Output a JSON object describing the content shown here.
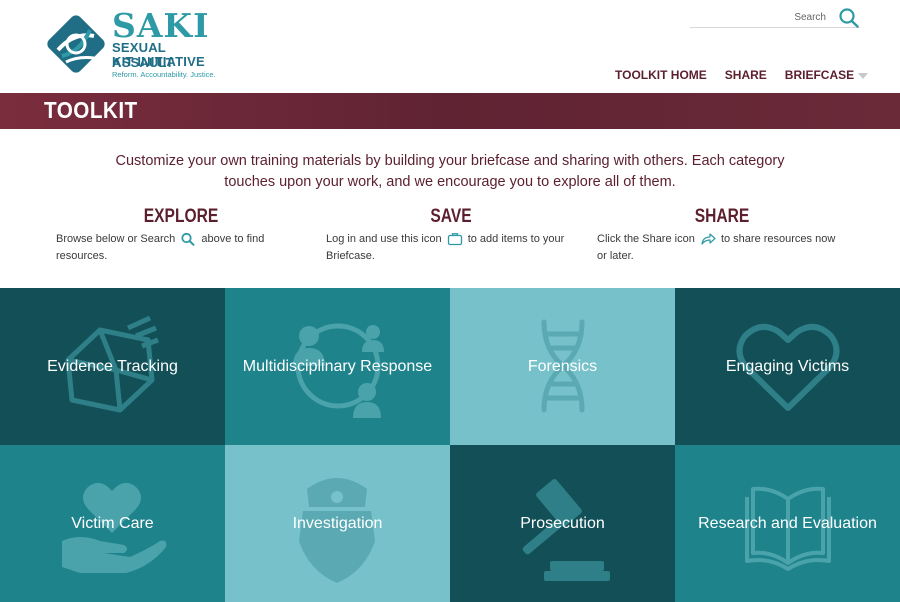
{
  "logo": {
    "title": "SAKI",
    "line1": "SEXUAL ASSAULT",
    "line2": "KIT INITIATIVE",
    "tagline": "Reform. Accountability. Justice."
  },
  "search": {
    "placeholder": "Search"
  },
  "nav": {
    "items": [
      {
        "label": "TOOLKIT HOME"
      },
      {
        "label": "SHARE"
      },
      {
        "label": "BRIEFCASE"
      }
    ]
  },
  "banner": {
    "title": "TOOLKIT"
  },
  "intro": {
    "text": "Customize your own training materials by building your briefcase and sharing with others. Each category touches upon your work, and we encourage you to explore all of them."
  },
  "columns": [
    {
      "title": "EXPLORE",
      "before": "Browse below or Search",
      "after": "above to find resources."
    },
    {
      "title": "SAVE",
      "before": "Log in and use this icon",
      "after": "to add items to your Briefcase."
    },
    {
      "title": "SHARE",
      "before": "Click the Share icon",
      "after": "to share resources now or later."
    }
  ],
  "tiles": [
    {
      "label": "Evidence Tracking",
      "color": "#134f57",
      "icon": "evidence-box-icon"
    },
    {
      "label": "Multidisciplinary Response",
      "color": "#1f838c",
      "icon": "team-circle-icon"
    },
    {
      "label": "Forensics",
      "color": "#77c1ca",
      "icon": "dna-icon"
    },
    {
      "label": "Engaging Victims",
      "color": "#134f57",
      "icon": "heart-icon"
    },
    {
      "label": "Victim Care",
      "color": "#1f838c",
      "icon": "heart-hand-icon"
    },
    {
      "label": "Investigation",
      "color": "#77c1ca",
      "icon": "badge-icon"
    },
    {
      "label": "Prosecution",
      "color": "#134f57",
      "icon": "gavel-icon"
    },
    {
      "label": "Research and Evaluation",
      "color": "#1f838c",
      "icon": "open-book-icon"
    }
  ],
  "colors": {
    "brand_teal": "#2e9aa6",
    "brand_maroon": "#5b1f2e"
  }
}
